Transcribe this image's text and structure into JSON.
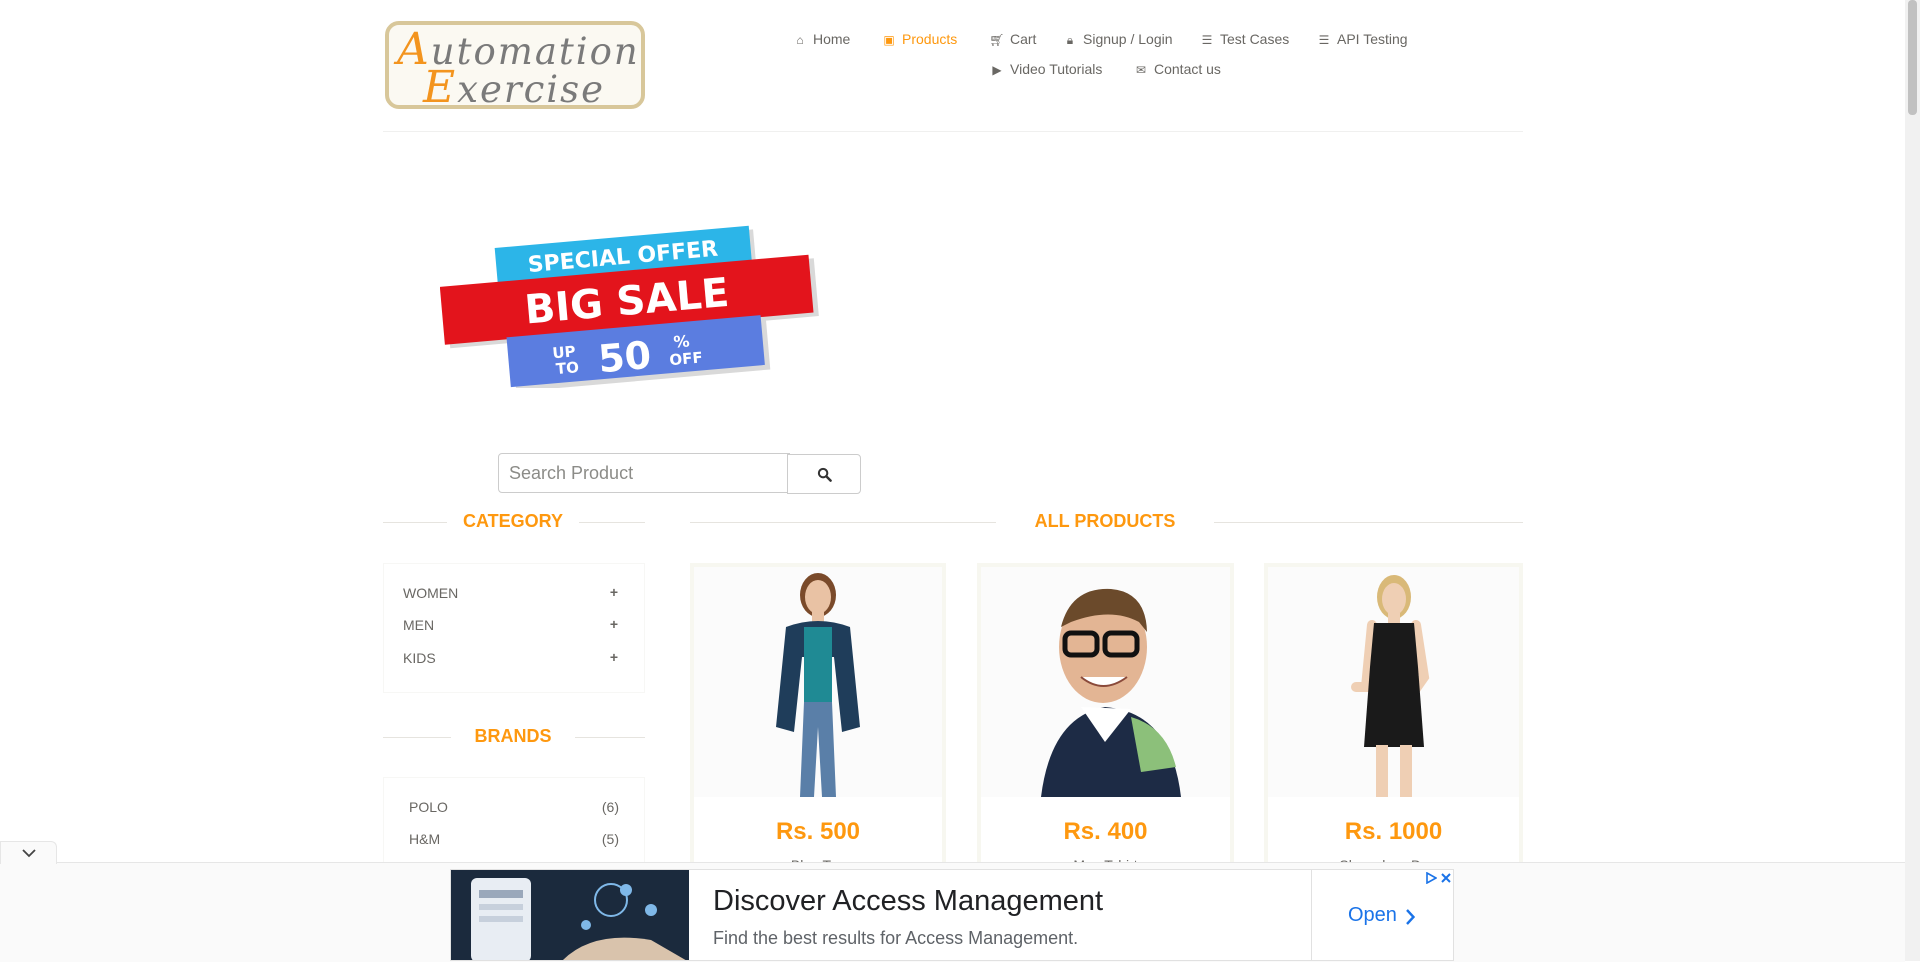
{
  "logo": {
    "line1_initial": "A",
    "line1_rest": "utomation",
    "line2_initial": "E",
    "line2_rest": "xercise"
  },
  "nav": {
    "home": "Home",
    "products": "Products",
    "cart": "Cart",
    "login": "Signup / Login",
    "test_cases": "Test Cases",
    "api_testing": "API Testing",
    "video_tutorials": "Video Tutorials",
    "contact": "Contact us"
  },
  "banner": {
    "line1": "SPECIAL OFFER",
    "line2": "BIG SALE",
    "up": "UP",
    "to": "TO",
    "percent": "50",
    "pct_sign": "%",
    "off": "OFF"
  },
  "search": {
    "placeholder": "Search Product"
  },
  "sidebar": {
    "category_title": "CATEGORY",
    "categories": [
      {
        "label": "WOMEN"
      },
      {
        "label": "MEN"
      },
      {
        "label": "KIDS"
      }
    ],
    "brands_title": "BRANDS",
    "brands": [
      {
        "label": "POLO",
        "count": "(6)"
      },
      {
        "label": "H&M",
        "count": "(5)"
      }
    ]
  },
  "products_title": "ALL PRODUCTS",
  "products": [
    {
      "price": "Rs. 500",
      "name": "Blue Top"
    },
    {
      "price": "Rs. 400",
      "name": "Men Tshirt"
    },
    {
      "price": "Rs. 1000",
      "name": "Sleeveless Dress"
    }
  ],
  "ad": {
    "title": "Discover Access Management",
    "description": "Find the best results for Access Management.",
    "cta": "Open"
  },
  "colors": {
    "accent": "#fe980f",
    "text": "#696763",
    "link": "#1a73e8"
  }
}
